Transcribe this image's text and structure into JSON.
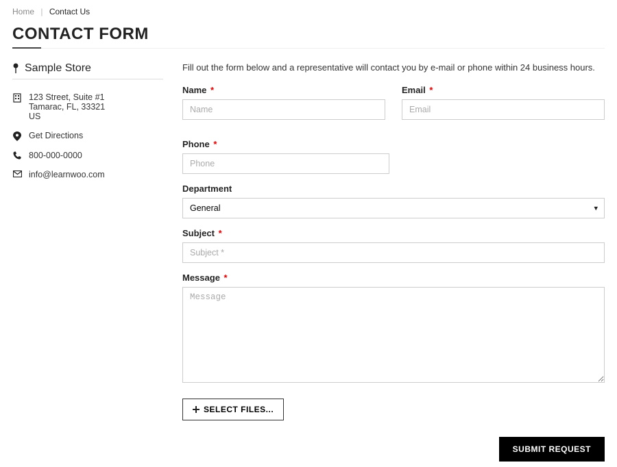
{
  "breadcrumb": {
    "home": "Home",
    "current": "Contact Us"
  },
  "page_title": "CONTACT FORM",
  "sidebar": {
    "store_name": "Sample Store",
    "address_line1": "123 Street, Suite #1",
    "address_line2": "Tamarac, FL, 33321",
    "address_line3": "US",
    "directions": "Get Directions",
    "phone": "800-000-0000",
    "email": "info@learnwoo.com"
  },
  "form": {
    "intro": "Fill out the form below and a representative will contact you by e-mail or phone within 24 business hours.",
    "name_label": "Name",
    "name_placeholder": "Name",
    "email_label": "Email",
    "email_placeholder": "Email",
    "phone_label": "Phone",
    "phone_placeholder": "Phone",
    "department_label": "Department",
    "department_value": "General",
    "subject_label": "Subject",
    "subject_placeholder": "Subject *",
    "message_label": "Message",
    "message_placeholder": "Message",
    "file_button": "SELECT FILES...",
    "submit_button": "SUBMIT REQUEST",
    "required_mark": "*"
  }
}
